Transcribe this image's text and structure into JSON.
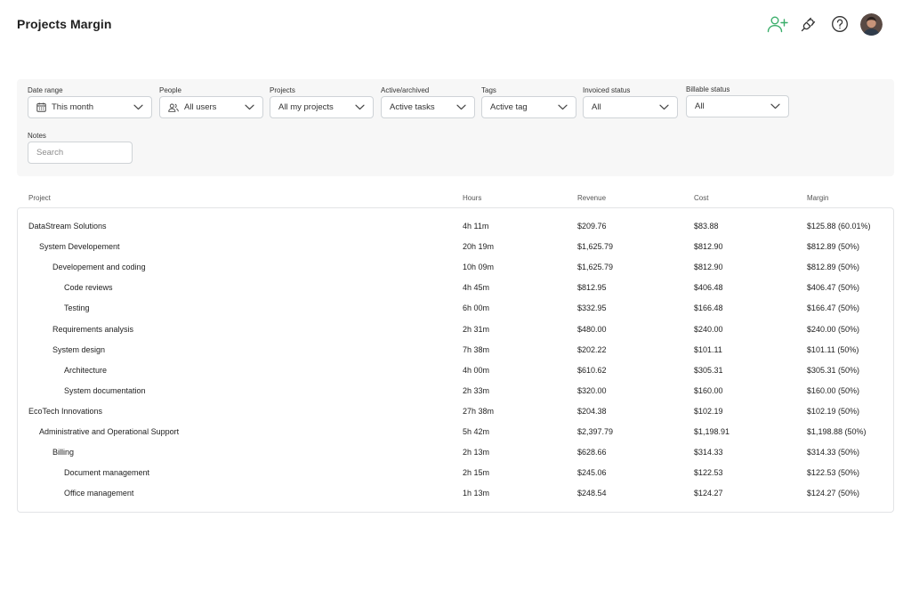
{
  "header": {
    "title": "Projects Margin",
    "icons": [
      "add-user-icon",
      "plug-icon",
      "help-icon",
      "avatar"
    ],
    "accent_color": "#3aae6a"
  },
  "filters": {
    "date_range": {
      "label": "Date range",
      "value": "This month"
    },
    "people": {
      "label": "People",
      "value": "All users"
    },
    "projects": {
      "label": "Projects",
      "value": "All my projects"
    },
    "active_archived": {
      "label": "Active/archived",
      "value": "Active tasks"
    },
    "tags": {
      "label": "Tags",
      "value": "Active tag"
    },
    "invoiced_status": {
      "label": "Invoiced status",
      "value": "All"
    },
    "billable_status": {
      "label": "Billable status",
      "value": "All"
    },
    "notes": {
      "label": "Notes",
      "placeholder": "Search"
    }
  },
  "table": {
    "columns": [
      "Project",
      "Hours",
      "Revenue",
      "Cost",
      "Margin"
    ],
    "rows": [
      {
        "level": 0,
        "name": "DataStream Solutions",
        "hours": "4h 11m",
        "revenue": "$209.76",
        "cost": "$83.88",
        "margin": "$125.88 (60.01%)"
      },
      {
        "level": 1,
        "name": "System Developement",
        "hours": "20h 19m",
        "revenue": "$1,625.79",
        "cost": "$812.90",
        "margin": "$812.89 (50%)"
      },
      {
        "level": 2,
        "name": "Developement and coding",
        "hours": "10h 09m",
        "revenue": "$1,625.79",
        "cost": "$812.90",
        "margin": "$812.89 (50%)"
      },
      {
        "level": 3,
        "name": "Code reviews",
        "hours": "4h 45m",
        "revenue": "$812.95",
        "cost": "$406.48",
        "margin": "$406.47 (50%)"
      },
      {
        "level": 3,
        "name": "Testing",
        "hours": "6h 00m",
        "revenue": "$332.95",
        "cost": "$166.48",
        "margin": "$166.47 (50%)"
      },
      {
        "level": 2,
        "name": "Requirements analysis",
        "hours": "2h 31m",
        "revenue": "$480.00",
        "cost": "$240.00",
        "margin": "$240.00 (50%)"
      },
      {
        "level": 2,
        "name": "System design",
        "hours": "7h 38m",
        "revenue": "$202.22",
        "cost": "$101.11",
        "margin": "$101.11 (50%)"
      },
      {
        "level": 3,
        "name": "Architecture",
        "hours": "4h 00m",
        "revenue": "$610.62",
        "cost": "$305.31",
        "margin": "$305.31 (50%)"
      },
      {
        "level": 3,
        "name": "System documentation",
        "hours": "2h 33m",
        "revenue": "$320.00",
        "cost": "$160.00",
        "margin": "$160.00 (50%)"
      },
      {
        "level": 0,
        "name": "EcoTech Innovations",
        "hours": "27h 38m",
        "revenue": "$204.38",
        "cost": "$102.19",
        "margin": "$102.19 (50%)"
      },
      {
        "level": 1,
        "name": "Administrative and Operational Support",
        "hours": "5h 42m",
        "revenue": "$2,397.79",
        "cost": "$1,198.91",
        "margin": "$1,198.88 (50%)"
      },
      {
        "level": 2,
        "name": "Billing",
        "hours": "2h 13m",
        "revenue": "$628.66",
        "cost": "$314.33",
        "margin": "$314.33 (50%)"
      },
      {
        "level": 3,
        "name": "Document management",
        "hours": "2h 15m",
        "revenue": "$245.06",
        "cost": "$122.53",
        "margin": "$122.53 (50%)"
      },
      {
        "level": 3,
        "name": "Office management",
        "hours": "1h 13m",
        "revenue": "$248.54",
        "cost": "$124.27",
        "margin": "$124.27 (50%)"
      }
    ]
  }
}
